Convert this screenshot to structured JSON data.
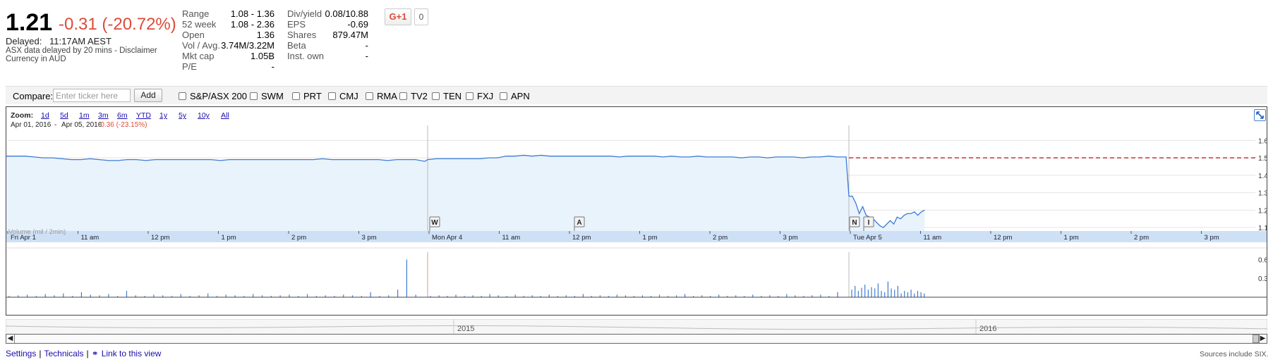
{
  "quote": {
    "price": "1.21",
    "change": "-0.31 (-20.72%)",
    "delayed_label": "Delayed:",
    "time": "11:17AM AEST",
    "disclaimer": "ASX data delayed by 20 mins - Disclaimer",
    "currency": "Currency in AUD"
  },
  "stats_left": [
    {
      "label": "Range",
      "value": "1.08 - 1.36"
    },
    {
      "label": "52 week",
      "value": "1.08 - 2.36"
    },
    {
      "label": "Open",
      "value": "1.36"
    },
    {
      "label": "Vol / Avg.",
      "value": "3.74M/3.22M"
    },
    {
      "label": "Mkt cap",
      "value": "1.05B"
    },
    {
      "label": "P/E",
      "value": "-"
    }
  ],
  "stats_right": [
    {
      "label": "Div/yield",
      "value": "0.08/10.88"
    },
    {
      "label": "EPS",
      "value": "-0.69"
    },
    {
      "label": "Shares",
      "value": "879.47M"
    },
    {
      "label": "Beta",
      "value": "-"
    },
    {
      "label": "Inst. own",
      "value": "-"
    }
  ],
  "social": {
    "gplus_label": "G+1",
    "count": "0"
  },
  "compare": {
    "label": "Compare:",
    "placeholder": "Enter ticker here",
    "add_label": "Add",
    "tickers": [
      "S&P/ASX 200",
      "SWM",
      "PRT",
      "CMJ",
      "RMA",
      "TV2",
      "TEN",
      "FXJ",
      "APN"
    ]
  },
  "chart": {
    "zoom_label": "Zoom:",
    "zoom_options": [
      "1d",
      "5d",
      "1m",
      "3m",
      "6m",
      "YTD",
      "1y",
      "5y",
      "10y",
      "All"
    ],
    "date_from": "Apr 01, 2016",
    "date_sep": "-",
    "date_to": "Apr 05, 2016",
    "range_change": "-0.36 (-23.15%)",
    "volume_label": "Volume (mil / 2min)",
    "overview_years": [
      "2015",
      "2016"
    ],
    "colors": {
      "line": "#3d7bd6",
      "fill": "#e9f3fc",
      "prev_close": "#cc3333",
      "change_red": "#dd4b39"
    }
  },
  "chart_data": {
    "type": "line",
    "x_ticks": [
      "Fri Apr 1",
      "11 am",
      "12 pm",
      "1 pm",
      "2 pm",
      "3 pm",
      "Mon Apr 4",
      "11 am",
      "12 pm",
      "1 pm",
      "2 pm",
      "3 pm",
      "Tue Apr 5",
      "11 am",
      "12 pm",
      "1 pm",
      "2 pm",
      "3 pm"
    ],
    "y_ticks": [
      "1.6",
      "1.5",
      "1.4",
      "1.3",
      "1.2",
      "1.1"
    ],
    "ylim": [
      1.08,
      1.63
    ],
    "previous_close": 1.5,
    "markers": [
      "W",
      "A",
      "N",
      "I"
    ],
    "series": [
      {
        "values": [
          1.51,
          1.51,
          1.51,
          1.505,
          1.5,
          1.5,
          1.495,
          1.49,
          1.49,
          1.495,
          1.49,
          1.485,
          1.485,
          1.49,
          1.49,
          1.485,
          1.49,
          1.49,
          1.49,
          1.49,
          1.49,
          1.49,
          1.49,
          1.485,
          1.49,
          1.49,
          1.49,
          1.49,
          1.49,
          1.49,
          1.49,
          1.49,
          1.49,
          1.49,
          1.495,
          1.49,
          1.49,
          1.49,
          1.49,
          1.49,
          1.49,
          1.485,
          1.49,
          1.49,
          1.49,
          1.48,
          1.49,
          1.495,
          1.495,
          1.495,
          1.495,
          1.495,
          1.495,
          1.5,
          1.5,
          1.51,
          1.51,
          1.515,
          1.51,
          1.515,
          1.51,
          1.51,
          1.51,
          1.51,
          1.51,
          1.51,
          1.51,
          1.51,
          1.505,
          1.51,
          1.51,
          1.51,
          1.51,
          1.505,
          1.51,
          1.505,
          1.505,
          1.51,
          1.505,
          1.505,
          1.505,
          1.505,
          1.5,
          1.505,
          1.505,
          1.5,
          1.505,
          1.505,
          1.505,
          1.5,
          1.505,
          1.505,
          1.51,
          1.505,
          1.505,
          1.28,
          1.28,
          1.24,
          1.18,
          1.22,
          1.17,
          1.16,
          1.15,
          1.13,
          1.11,
          1.1,
          1.12,
          1.14,
          1.12,
          1.16,
          1.15,
          1.17,
          1.18,
          1.18,
          1.19,
          1.17,
          1.19,
          1.2
        ]
      }
    ],
    "volume": {
      "ylim": [
        0,
        0.65
      ],
      "y_ticks": [
        "0.6",
        "0.3"
      ],
      "values": [
        0.02,
        0.03,
        0.04,
        0.02,
        0.05,
        0.03,
        0.06,
        0.02,
        0.08,
        0.04,
        0.03,
        0.05,
        0.02,
        0.1,
        0.03,
        0.02,
        0.04,
        0.03,
        0.02,
        0.05,
        0.02,
        0.03,
        0.06,
        0.02,
        0.04,
        0.03,
        0.02,
        0.05,
        0.03,
        0.02,
        0.03,
        0.04,
        0.02,
        0.05,
        0.02,
        0.03,
        0.02,
        0.04,
        0.03,
        0.02,
        0.08,
        0.02,
        0.03,
        0.12,
        0.6,
        0.04,
        0.02,
        0.03,
        0.02,
        0.04,
        0.02,
        0.03,
        0.02,
        0.05,
        0.03,
        0.02,
        0.04,
        0.02,
        0.03,
        0.02,
        0.04,
        0.02,
        0.03,
        0.02,
        0.05,
        0.02,
        0.03,
        0.02,
        0.04,
        0.03,
        0.02,
        0.03,
        0.02,
        0.04,
        0.02,
        0.03,
        0.05,
        0.02,
        0.03,
        0.02,
        0.04,
        0.02,
        0.03,
        0.02,
        0.04,
        0.02,
        0.03,
        0.02,
        0.05,
        0.03,
        0.02,
        0.03,
        0.04,
        0.02,
        0.08,
        0.12,
        0.18,
        0.1,
        0.15,
        0.2,
        0.12,
        0.16,
        0.14,
        0.22,
        0.1,
        0.08,
        0.25,
        0.14,
        0.12,
        0.18,
        0.06,
        0.1,
        0.08,
        0.12,
        0.06,
        0.1,
        0.08,
        0.06
      ]
    }
  },
  "footer": {
    "settings": "Settings",
    "sep1": "|",
    "technicals": "Technicals",
    "sep2": "|",
    "link_label": "Link to this view",
    "sources": "Sources include SIX."
  }
}
